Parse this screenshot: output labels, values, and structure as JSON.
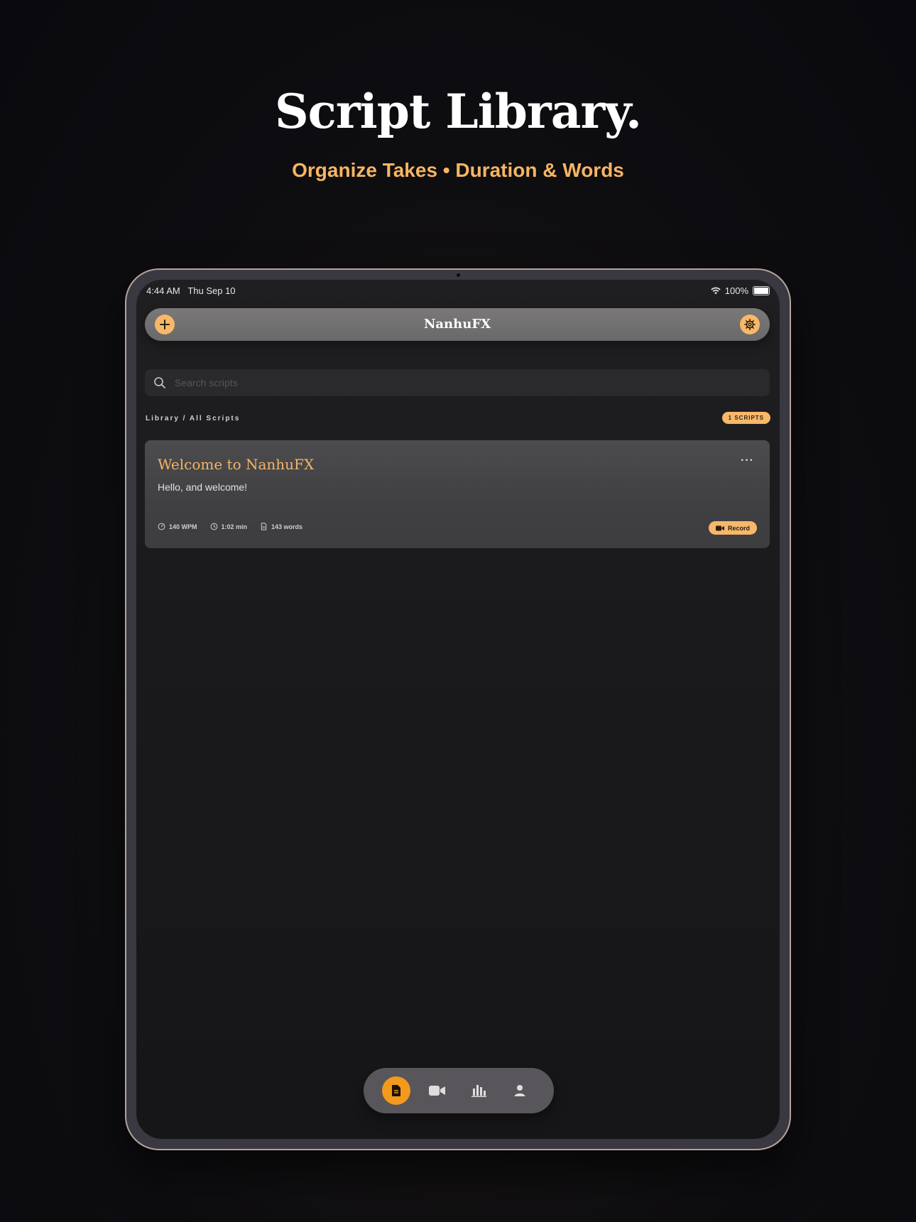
{
  "hero": {
    "title": "Script Library.",
    "subtitle": "Organize Takes • Duration & Words"
  },
  "status_bar": {
    "time": "4:44 AM",
    "date": "Thu Sep 10",
    "battery": "100%"
  },
  "nav": {
    "title": "NanhuFX",
    "add_icon": "plus-icon",
    "settings_icon": "gear-icon"
  },
  "search": {
    "placeholder": "Search scripts"
  },
  "library": {
    "breadcrumb": "Library / All Scripts",
    "count_badge": "1 SCRIPTS"
  },
  "scripts": [
    {
      "title": "Welcome to NanhuFX",
      "preview": "Hello, and welcome!",
      "wpm": "140 WPM",
      "duration": "1:02 min",
      "words": "143 words",
      "record_label": "Record",
      "menu": "···"
    }
  ],
  "tabs": [
    {
      "icon": "document-icon",
      "active": true
    },
    {
      "icon": "video-camera-icon",
      "active": false
    },
    {
      "icon": "bar-chart-icon",
      "active": false
    },
    {
      "icon": "person-icon",
      "active": false
    }
  ],
  "colors": {
    "accent": "#f7b86a",
    "accent_active": "#f39a1c",
    "title_gold": "#f5b465",
    "background": "#19191b"
  }
}
